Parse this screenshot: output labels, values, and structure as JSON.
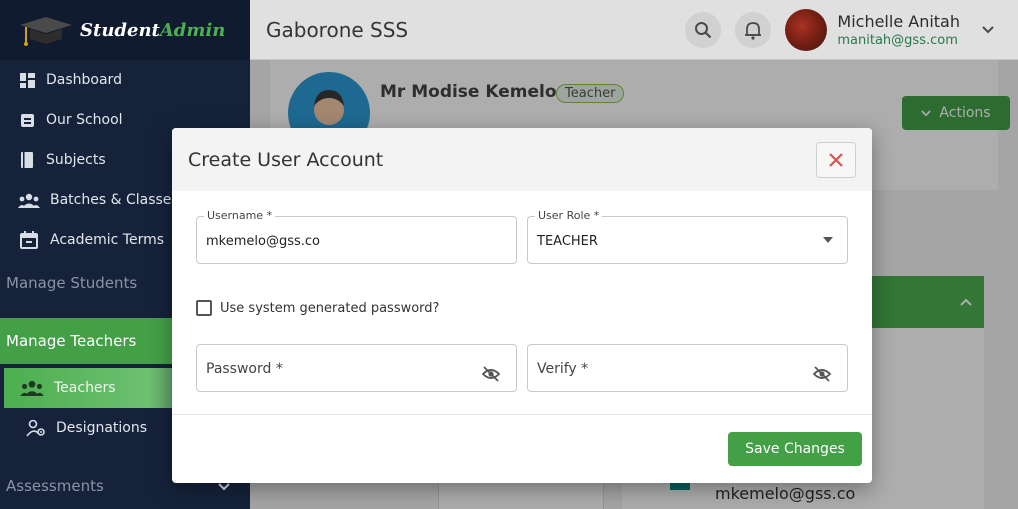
{
  "brand": {
    "part1": "Student",
    "part2": "Admin"
  },
  "sidebar": {
    "items": [
      {
        "label": "Dashboard",
        "icon": "dashboard-icon"
      },
      {
        "label": "Our School",
        "icon": "school-icon"
      },
      {
        "label": "Subjects",
        "icon": "book-icon"
      },
      {
        "label": "Batches & Classes",
        "icon": "people-icon"
      },
      {
        "label": "Academic Terms",
        "icon": "calendar-icon"
      }
    ],
    "section_students": "Manage Students",
    "section_teachers": "Manage Teachers",
    "sub_items": [
      {
        "label": "Teachers",
        "icon": "people-icon"
      },
      {
        "label": "Designations",
        "icon": "person-gear-icon"
      }
    ],
    "section_assessments": "Assessments"
  },
  "topbar": {
    "school": "Gaborone SSS",
    "user_name": "Michelle Anitah",
    "user_email": "manitah@gss.com"
  },
  "profile": {
    "name": "Mr Modise Kemelo",
    "role": "Teacher",
    "actions_label": "Actions",
    "email_bg": "mkemelo@gss.co"
  },
  "modal": {
    "title": "Create User Account",
    "username_label": "Username *",
    "username_value": "mkemelo@gss.co",
    "role_label": "User Role *",
    "role_value": "TEACHER",
    "checkbox_label": "Use system generated password?",
    "password_placeholder": "Password *",
    "verify_placeholder": "Verify *",
    "save_label": "Save Changes"
  },
  "colors": {
    "sidebar_bg": "#15223a",
    "accent_green": "#43a047",
    "close_red": "#d9534f"
  }
}
